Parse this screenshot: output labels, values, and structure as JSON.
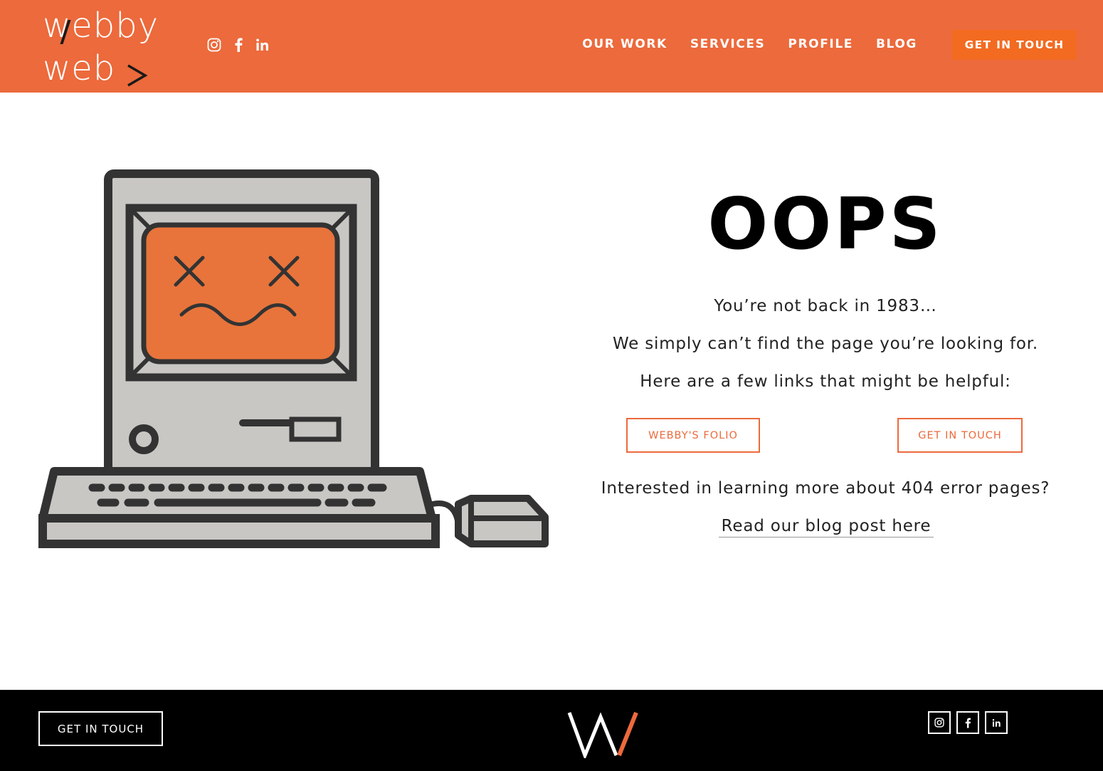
{
  "header": {
    "logo": {
      "line1": "webby",
      "line2": "web",
      "chevron": ">"
    },
    "social_icons": [
      "instagram-icon",
      "facebook-icon",
      "linkedin-icon"
    ],
    "nav": [
      {
        "label": "OUR WORK"
      },
      {
        "label": "SERVICES"
      },
      {
        "label": "PROFILE"
      },
      {
        "label": "BLOG"
      }
    ],
    "cta_label": "GET IN TOUCH"
  },
  "main": {
    "illustration": "sad-computer-icon",
    "title": "OOPS",
    "line1": "You’re not back in 1983…",
    "line2": "We simply can’t find the page you’re looking for.",
    "line3": "Here are a few links that might be helpful:",
    "buttons": [
      {
        "label": "WEBBY'S FOLIO"
      },
      {
        "label": "GET IN TOUCH"
      }
    ],
    "line4": "Interested in learning more about 404 error pages?",
    "blog_link": "Read our blog post here"
  },
  "footer": {
    "cta_label": "GET IN TOUCH",
    "logo": "w-logo-icon",
    "social_icons": [
      "instagram-icon",
      "facebook-icon",
      "linkedin-icon"
    ]
  },
  "colors": {
    "brand_orange": "#ec6a3c",
    "cta_orange": "#f26b21",
    "footer_bg": "#000000",
    "computer_gray": "#c8c7c4",
    "outline_dark": "#333333"
  }
}
